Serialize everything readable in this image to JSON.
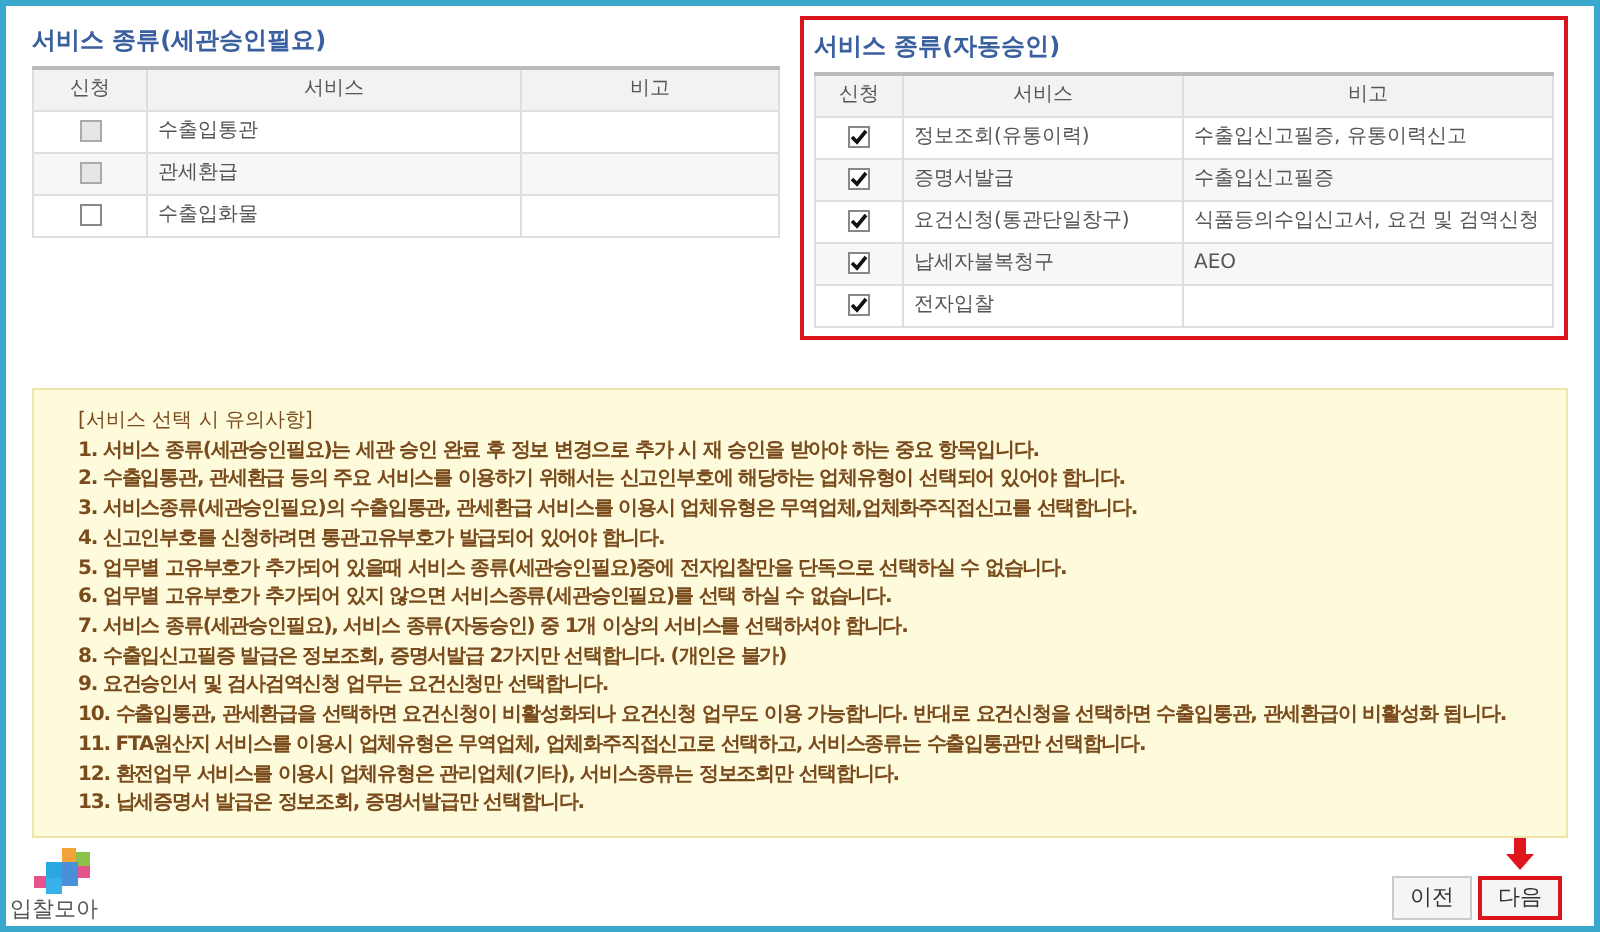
{
  "panels": [
    {
      "title": "서비스 종류(세관승인필요)",
      "highlighted": false,
      "columns": [
        "신청",
        "서비스",
        "비고"
      ],
      "rows": [
        {
          "checked": false,
          "disabled": true,
          "service": "수출입통관"
        },
        {
          "checked": false,
          "disabled": true,
          "service": "관세환급"
        },
        {
          "checked": false,
          "disabled": false,
          "service": "수출입화물"
        }
      ]
    },
    {
      "title": "서비스 종류(자동승인)",
      "highlighted": true,
      "columns": [
        "신청",
        "서비스",
        "비고"
      ],
      "rows": [
        {
          "checked": true,
          "disabled": false,
          "service": "정보조회(유통이력)",
          "note": "수출입신고필증, 유통이력신고"
        },
        {
          "checked": true,
          "disabled": false,
          "service": "증명서발급",
          "note": "수출입신고필증"
        },
        {
          "checked": true,
          "disabled": false,
          "service": "요건신청(통관단일창구)",
          "note": "식품등의수입신고서, 요건 및 검역신청"
        },
        {
          "checked": true,
          "disabled": false,
          "service": "납세자불복청구",
          "note": "AEO"
        },
        {
          "checked": true,
          "disabled": false,
          "service": "전자입찰"
        }
      ]
    }
  ],
  "notes": {
    "heading": "[서비스 선택 시 유의사항]",
    "items": [
      "1. 서비스 종류(세관승인필요)는 세관 승인 완료 후 정보 변경으로 추가 시 재 승인을 받아야 하는 중요 항목입니다.",
      "2. 수출입통관, 관세환급 등의 주요 서비스를 이용하기 위해서는 신고인부호에 해당하는 업체유형이 선택되어 있어야 합니다.",
      "3. 서비스종류(세관승인필요)의 수출입통관, 관세환급 서비스를 이용시 업체유형은 무역업체,업체화주직접신고를 선택합니다.",
      "4. 신고인부호를 신청하려면 통관고유부호가 발급되어 있어야 합니다.",
      "5. 업무별 고유부호가 추가되어 있을때 서비스 종류(세관승인필요)중에 전자입찰만을 단독으로 선택하실 수 없습니다.",
      "6. 업무별 고유부호가 추가되어 있지 않으면 서비스종류(세관승인필요)를 선택 하실 수 없습니다.",
      "7. 서비스 종류(세관승인필요), 서비스 종류(자동승인) 중 1개 이상의 서비스를 선택하셔야 합니다.",
      "8. 수출입신고필증 발급은 정보조회, 증명서발급 2가지만 선택합니다. (개인은 불가)",
      "9. 요건승인서 및 검사검역신청 업무는 요건신청만 선택합니다.",
      "10. 수출입통관, 관세환급을 선택하면 요건신청이 비활성화되나 요건신청 업무도 이용 가능합니다. 반대로 요건신청을 선택하면 수출입통관, 관세환급이 비활성화 됩니다.",
      "11. FTA원산지 서비스를 이용시 업체유형은 무역업체, 업체화주직접신고로 선택하고, 서비스종류는 수출입통관만 선택합니다.",
      "12. 환전업무 서비스를 이용시 업체유형은 관리업체(기타), 서비스종류는 정보조회만 선택합니다.",
      "13. 납세증명서 발급은 정보조회, 증명서발급만 선택합니다."
    ]
  },
  "logo": {
    "text": "입찰모아"
  },
  "buttons": [
    {
      "label": "이전",
      "highlighted": false
    },
    {
      "label": "다음",
      "highlighted": true
    }
  ]
}
